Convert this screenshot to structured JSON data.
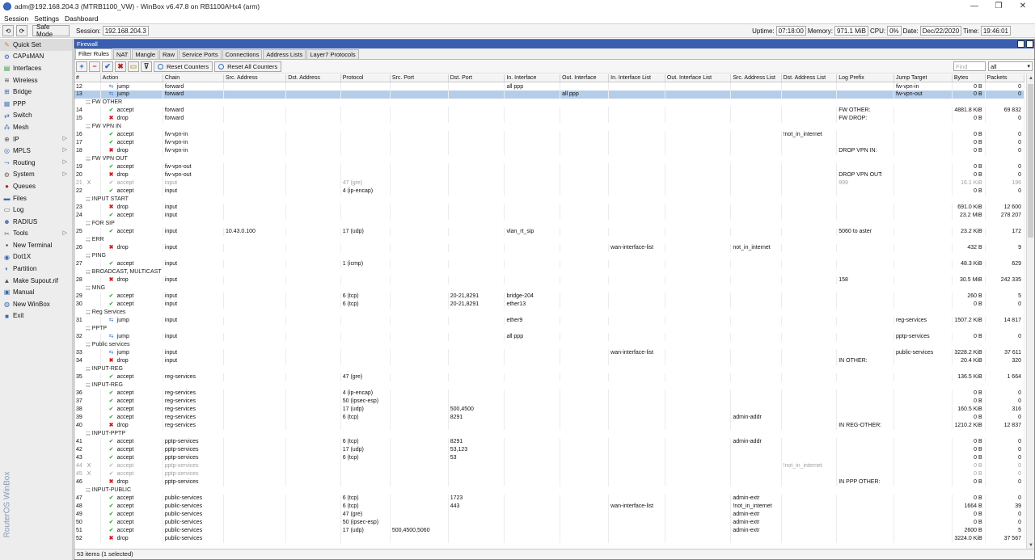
{
  "window": {
    "title": "adm@192.168.204.3 (MTRB1100_VW) - WinBox v6.47.8 on RB1100AHx4 (arm)"
  },
  "menu": [
    "Session",
    "Settings",
    "Dashboard"
  ],
  "toolbar": {
    "safe_mode": "Safe Mode",
    "session_label": "Session:",
    "session_value": "192.168.204.3",
    "uptime_label": "Uptime:",
    "uptime_value": "07:18:00",
    "memory_label": "Memory:",
    "memory_value": "971.1 MiB",
    "cpu_label": "CPU:",
    "cpu_value": "0%",
    "date_label": "Date:",
    "date_value": "Dec/22/2020",
    "time_label": "Time:",
    "time_value": "19:46:01"
  },
  "sidebar": {
    "items": [
      {
        "label": "Quick Set",
        "icon": "quick-set-icon",
        "glyph": "✎",
        "color": "#c88a20",
        "sub": false
      },
      {
        "label": "CAPsMAN",
        "icon": "capsman-icon",
        "glyph": "⚙",
        "color": "#4a6ab0",
        "sub": false
      },
      {
        "label": "Interfaces",
        "icon": "interfaces-icon",
        "glyph": "▤",
        "color": "#3a9a3a",
        "sub": false
      },
      {
        "label": "Wireless",
        "icon": "wireless-icon",
        "glyph": "≋",
        "color": "#555",
        "sub": false
      },
      {
        "label": "Bridge",
        "icon": "bridge-icon",
        "glyph": "⊞",
        "color": "#3a6ab0",
        "sub": false
      },
      {
        "label": "PPP",
        "icon": "ppp-icon",
        "glyph": "▦",
        "color": "#5a80c0",
        "sub": false
      },
      {
        "label": "Switch",
        "icon": "switch-icon",
        "glyph": "⇄",
        "color": "#3a6ab0",
        "sub": false
      },
      {
        "label": "Mesh",
        "icon": "mesh-icon",
        "glyph": "⁂",
        "color": "#3a6ab0",
        "sub": false
      },
      {
        "label": "IP",
        "icon": "ip-icon",
        "glyph": "⊕",
        "color": "#555",
        "sub": true
      },
      {
        "label": "MPLS",
        "icon": "mpls-icon",
        "glyph": "◎",
        "color": "#4a6ab0",
        "sub": true
      },
      {
        "label": "Routing",
        "icon": "routing-icon",
        "glyph": "⤳",
        "color": "#3a6ab0",
        "sub": true
      },
      {
        "label": "System",
        "icon": "system-icon",
        "glyph": "⚙",
        "color": "#666",
        "sub": true
      },
      {
        "label": "Queues",
        "icon": "queues-icon",
        "glyph": "●",
        "color": "#c02020",
        "sub": false
      },
      {
        "label": "Files",
        "icon": "files-icon",
        "glyph": "▬",
        "color": "#3a6ab0",
        "sub": false
      },
      {
        "label": "Log",
        "icon": "log-icon",
        "glyph": "▭",
        "color": "#555",
        "sub": false
      },
      {
        "label": "RADIUS",
        "icon": "radius-icon",
        "glyph": "☻",
        "color": "#4a6ab0",
        "sub": false
      },
      {
        "label": "Tools",
        "icon": "tools-icon",
        "glyph": "✂",
        "color": "#666",
        "sub": true
      },
      {
        "label": "New Terminal",
        "icon": "terminal-icon",
        "glyph": "▪",
        "color": "#222",
        "sub": false
      },
      {
        "label": "Dot1X",
        "icon": "dot1x-icon",
        "glyph": "◉",
        "color": "#3a6ab0",
        "sub": false
      },
      {
        "label": "Partition",
        "icon": "partition-icon",
        "glyph": "◐",
        "color": "#3a6ab0",
        "sub": false
      },
      {
        "label": "Make Supout.rif",
        "icon": "supout-icon",
        "glyph": "▲",
        "color": "#555",
        "sub": false
      },
      {
        "label": "Manual",
        "icon": "manual-icon",
        "glyph": "▣",
        "color": "#3a6ab0",
        "sub": false
      },
      {
        "label": "New WinBox",
        "icon": "new-winbox-icon",
        "glyph": "◍",
        "color": "#3a6ab0",
        "sub": false
      },
      {
        "label": "Exit",
        "icon": "exit-icon",
        "glyph": "■",
        "color": "#3a6ab0",
        "sub": false
      }
    ],
    "brand": "RouterOS WinBox"
  },
  "firewall": {
    "title": "Firewall",
    "tabs": [
      "Filter Rules",
      "NAT",
      "Mangle",
      "Raw",
      "Service Ports",
      "Connections",
      "Address Lists",
      "Layer7 Protocols"
    ],
    "reset_counters": "Reset Counters",
    "reset_all_counters": "Reset All Counters",
    "find_placeholder": "Find",
    "filter_value": "all",
    "columns": [
      "#",
      "Action",
      "Chain",
      "Src. Address",
      "Dst. Address",
      "Protocol",
      "Src. Port",
      "Dst. Port",
      "In. Interface",
      "Out. Interface",
      "In. Interface List",
      "Out. Interface List",
      "Src. Address List",
      "Dst. Address List",
      "Log Prefix",
      "Jump Target",
      "Bytes",
      "Packets"
    ],
    "rows": [
      {
        "type": "rule",
        "n": "12",
        "action": "jump",
        "chain": "forward",
        "inif": "all ppp",
        "jump": "fw-vpn-in",
        "bytes": "0 B",
        "packets": "0"
      },
      {
        "type": "rule",
        "n": "13",
        "action": "jump",
        "chain": "forward",
        "outif": "all ppp",
        "jump": "fw-vpn-out",
        "bytes": "0 B",
        "packets": "0",
        "selected": true
      },
      {
        "type": "comment",
        "text": ";;; FW OTHER"
      },
      {
        "type": "rule",
        "n": "14",
        "action": "accept",
        "chain": "forward",
        "logp": "FW OTHER:",
        "bytes": "4881.8 KiB",
        "packets": "69 832"
      },
      {
        "type": "rule",
        "n": "15",
        "action": "drop",
        "chain": "forward",
        "logp": "FW DROP:",
        "bytes": "0 B",
        "packets": "0"
      },
      {
        "type": "comment",
        "text": ";;; FW VPN IN"
      },
      {
        "type": "rule",
        "n": "16",
        "action": "accept",
        "chain": "fw-vpn-in",
        "dstl": "!not_in_internet",
        "bytes": "0 B",
        "packets": "0"
      },
      {
        "type": "rule",
        "n": "17",
        "action": "accept",
        "chain": "fw-vpn-in",
        "bytes": "0 B",
        "packets": "0"
      },
      {
        "type": "rule",
        "n": "18",
        "action": "drop",
        "chain": "fw-vpn-in",
        "logp": "DROP VPN IN:",
        "bytes": "0 B",
        "packets": "0"
      },
      {
        "type": "comment",
        "text": ";;; FW VPN OUT"
      },
      {
        "type": "rule",
        "n": "19",
        "action": "accept",
        "chain": "fw-vpn-out",
        "bytes": "0 B",
        "packets": "0"
      },
      {
        "type": "rule",
        "n": "20",
        "action": "drop",
        "chain": "fw-vpn-out",
        "logp": "DROP VPN OUT:",
        "bytes": "0 B",
        "packets": "0"
      },
      {
        "type": "rule",
        "n": "21",
        "dis": "X",
        "action": "accept",
        "chain": "input",
        "proto": "47 (gre)",
        "logp": "999",
        "bytes": "16.1 KiB",
        "packets": "196",
        "disabled": true
      },
      {
        "type": "rule",
        "n": "22",
        "action": "accept",
        "chain": "input",
        "proto": "4 (ip-encap)",
        "bytes": "0 B",
        "packets": "0"
      },
      {
        "type": "comment",
        "text": ";;; INPUT START"
      },
      {
        "type": "rule",
        "n": "23",
        "action": "drop",
        "chain": "input",
        "bytes": "691.0 KiB",
        "packets": "12 600"
      },
      {
        "type": "rule",
        "n": "24",
        "action": "accept",
        "chain": "input",
        "bytes": "23.2 MiB",
        "packets": "278 207"
      },
      {
        "type": "comment",
        "text": ";;; FOR SIP"
      },
      {
        "type": "rule",
        "n": "25",
        "action": "accept",
        "chain": "input",
        "src": "10.43.0.100",
        "proto": "17 (udp)",
        "inif": "vlan_rt_sip",
        "logp": "5060 to aster",
        "bytes": "23.2 KiB",
        "packets": "172"
      },
      {
        "type": "comment",
        "text": ";;; ERR"
      },
      {
        "type": "rule",
        "n": "26",
        "action": "drop",
        "chain": "input",
        "inl": "wan-interface-list",
        "srcl": "not_in_internet",
        "bytes": "432 B",
        "packets": "9"
      },
      {
        "type": "comment",
        "text": ";;; PING"
      },
      {
        "type": "rule",
        "n": "27",
        "action": "accept",
        "chain": "input",
        "proto": "1 (icmp)",
        "bytes": "48.3 KiB",
        "packets": "629"
      },
      {
        "type": "comment",
        "text": ";;; BROADCAST, MULTICAST"
      },
      {
        "type": "rule",
        "n": "28",
        "action": "drop",
        "chain": "input",
        "logp": "158",
        "bytes": "30.5 MiB",
        "packets": "242 335"
      },
      {
        "type": "comment",
        "text": ";;; MNG"
      },
      {
        "type": "rule",
        "n": "29",
        "action": "accept",
        "chain": "input",
        "proto": "6 (tcp)",
        "dport": "20-21,8291",
        "inif": "bridge-204",
        "bytes": "260 B",
        "packets": "5"
      },
      {
        "type": "rule",
        "n": "30",
        "action": "accept",
        "chain": "input",
        "proto": "6 (tcp)",
        "dport": "20-21,8291",
        "inif": "ether13",
        "bytes": "0 B",
        "packets": "0"
      },
      {
        "type": "comment",
        "text": ";;; Reg Services"
      },
      {
        "type": "rule",
        "n": "31",
        "action": "jump",
        "chain": "input",
        "inif": "ether9",
        "jump": "reg-services",
        "bytes": "1507.2 KiB",
        "packets": "14 817"
      },
      {
        "type": "comment",
        "text": ";;; PPTP"
      },
      {
        "type": "rule",
        "n": "32",
        "action": "jump",
        "chain": "input",
        "inif": "all ppp",
        "jump": "pptp-services",
        "bytes": "0 B",
        "packets": "0"
      },
      {
        "type": "comment",
        "text": ";;; Public services"
      },
      {
        "type": "rule",
        "n": "33",
        "action": "jump",
        "chain": "input",
        "inl": "wan-interface-list",
        "jump": "public-services",
        "bytes": "3228.2 KiB",
        "packets": "37 611"
      },
      {
        "type": "rule",
        "n": "34",
        "action": "drop",
        "chain": "input",
        "logp": "IN OTHER:",
        "bytes": "20.4 KiB",
        "packets": "320"
      },
      {
        "type": "comment",
        "text": ";;; INPUT-REG"
      },
      {
        "type": "rule",
        "n": "35",
        "action": "accept",
        "chain": "reg-services",
        "proto": "47 (gre)",
        "bytes": "136.5 KiB",
        "packets": "1 664"
      },
      {
        "type": "comment",
        "text": ";;; INPUT-REG"
      },
      {
        "type": "rule",
        "n": "36",
        "action": "accept",
        "chain": "reg-services",
        "proto": "4 (ip-encap)",
        "bytes": "0 B",
        "packets": "0"
      },
      {
        "type": "rule",
        "n": "37",
        "action": "accept",
        "chain": "reg-services",
        "proto": "50 (ipsec-esp)",
        "bytes": "0 B",
        "packets": "0"
      },
      {
        "type": "rule",
        "n": "38",
        "action": "accept",
        "chain": "reg-services",
        "proto": "17 (udp)",
        "dport": "500,4500",
        "bytes": "160.5 KiB",
        "packets": "316"
      },
      {
        "type": "rule",
        "n": "39",
        "action": "accept",
        "chain": "reg-services",
        "proto": "6 (tcp)",
        "dport": "8291",
        "srcl": "admin-addr",
        "bytes": "0 B",
        "packets": "0"
      },
      {
        "type": "rule",
        "n": "40",
        "action": "drop",
        "chain": "reg-services",
        "logp": "IN REG-OTHER:",
        "bytes": "1210.2 KiB",
        "packets": "12 837"
      },
      {
        "type": "comment",
        "text": ";;; INPUT-PPTP"
      },
      {
        "type": "rule",
        "n": "41",
        "action": "accept",
        "chain": "pptp-services",
        "proto": "6 (tcp)",
        "dport": "8291",
        "srcl": "admin-addr",
        "bytes": "0 B",
        "packets": "0"
      },
      {
        "type": "rule",
        "n": "42",
        "action": "accept",
        "chain": "pptp-services",
        "proto": "17 (udp)",
        "dport": "53,123",
        "bytes": "0 B",
        "packets": "0"
      },
      {
        "type": "rule",
        "n": "43",
        "action": "accept",
        "chain": "pptp-services",
        "proto": "6 (tcp)",
        "dport": "53",
        "bytes": "0 B",
        "packets": "0"
      },
      {
        "type": "rule",
        "n": "44",
        "dis": "X",
        "action": "accept",
        "chain": "pptp-services",
        "dstl": "!not_in_internet",
        "bytes": "0 B",
        "packets": "0",
        "disabled": true
      },
      {
        "type": "rule",
        "n": "45",
        "dis": "X",
        "action": "accept",
        "chain": "pptp-services",
        "bytes": "0 B",
        "packets": "0",
        "disabled": true
      },
      {
        "type": "rule",
        "n": "46",
        "action": "drop",
        "chain": "pptp-services",
        "logp": "IN PPP OTHER:",
        "bytes": "0 B",
        "packets": "0"
      },
      {
        "type": "comment",
        "text": ";;; INPUT-PUBLIC"
      },
      {
        "type": "rule",
        "n": "47",
        "action": "accept",
        "chain": "public-services",
        "proto": "6 (tcp)",
        "dport": "1723",
        "srcl": "admin-extr",
        "bytes": "0 B",
        "packets": "0"
      },
      {
        "type": "rule",
        "n": "48",
        "action": "accept",
        "chain": "public-services",
        "proto": "6 (tcp)",
        "dport": "443",
        "inl": "wan-interface-list",
        "srcl": "!not_in_internet",
        "bytes": "1664 B",
        "packets": "39"
      },
      {
        "type": "rule",
        "n": "49",
        "action": "accept",
        "chain": "public-services",
        "proto": "47 (gre)",
        "srcl": "admin-extr",
        "bytes": "0 B",
        "packets": "0"
      },
      {
        "type": "rule",
        "n": "50",
        "action": "accept",
        "chain": "public-services",
        "proto": "50 (ipsec-esp)",
        "srcl": "admin-extr",
        "bytes": "0 B",
        "packets": "0"
      },
      {
        "type": "rule",
        "n": "51",
        "action": "accept",
        "chain": "public-services",
        "proto": "17 (udp)",
        "sport": "500,4500,5060",
        "srcl": "admin-extr",
        "bytes": "2600 B",
        "packets": "5"
      },
      {
        "type": "rule",
        "n": "52",
        "action": "drop",
        "chain": "public-services",
        "bytes": "3224.0 KiB",
        "packets": "37 567"
      }
    ],
    "status": "53 items (1 selected)"
  },
  "colors": {
    "accept": "#23a023",
    "drop": "#d02020",
    "jump": "#3c78c8",
    "selected_row": "#b6cdea",
    "window_title": "#3a5fb0"
  }
}
